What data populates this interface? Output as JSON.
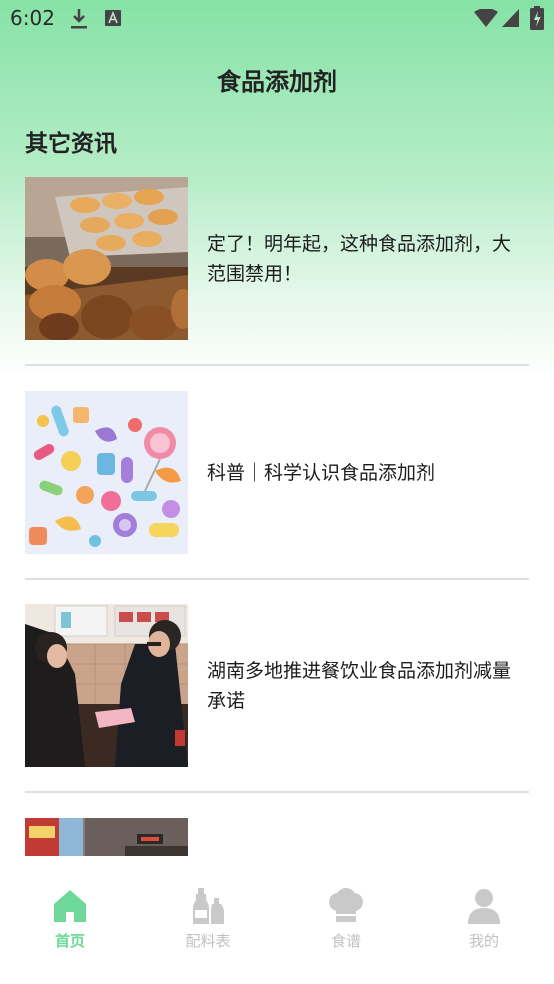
{
  "status_bar": {
    "time": "6:02"
  },
  "header": {
    "title": "食品添加剂"
  },
  "section": {
    "title": "其它资讯"
  },
  "news": [
    {
      "title": "定了！明年起，这种食品添加剂，大范围禁用！"
    },
    {
      "title": "科普｜科学认识食品添加剂"
    },
    {
      "title": "湖南多地推进餐饮业食品添加剂减量承诺"
    }
  ],
  "tabs": [
    {
      "label": "首页",
      "icon": "home-icon",
      "active": true
    },
    {
      "label": "配料表",
      "icon": "bottles-icon",
      "active": false
    },
    {
      "label": "食谱",
      "icon": "chef-hat-icon",
      "active": false
    },
    {
      "label": "我的",
      "icon": "user-icon",
      "active": false
    }
  ],
  "colors": {
    "accent": "#6dd89a",
    "header_green": "#86e2a6",
    "inactive": "#c2c2c2"
  }
}
